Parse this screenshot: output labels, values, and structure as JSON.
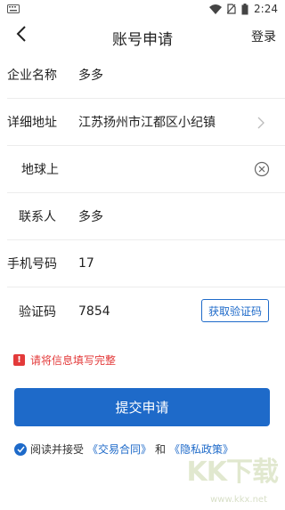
{
  "status_bar": {
    "time": "2:24",
    "keyboard_icon": "keyboard-icon",
    "wifi_icon": "wifi-icon",
    "sim_icon": "no-sim-icon",
    "battery_icon": "battery-icon"
  },
  "nav": {
    "title": "账号申请",
    "login_label": "登录",
    "back_icon": "chevron-left-icon"
  },
  "form": {
    "company": {
      "label": "企业名称",
      "value": "多多"
    },
    "address": {
      "label": "详细地址",
      "value": "江苏扬州市江都区小纪镇",
      "icon": "chevron-right-icon"
    },
    "address_detail": {
      "label": "地球上",
      "value": "",
      "icon": "clear-icon"
    },
    "contact": {
      "label": "联系人",
      "value": "多多"
    },
    "phone": {
      "label": "手机号码",
      "value": "17"
    },
    "code": {
      "label": "验证码",
      "value": "7854",
      "button_label": "获取验证码"
    }
  },
  "error": {
    "icon": "alert-icon",
    "text": "请将信息填写完整"
  },
  "submit_label": "提交申请",
  "agreement": {
    "prefix": "阅读并接受",
    "contract_link": "《交易合同》",
    "conjunction": "和",
    "privacy_link": "《隐私政策》",
    "check_icon": "checkmark-icon"
  },
  "watermark": {
    "brand": "KK下载",
    "url": "www.kkx.net"
  },
  "colors": {
    "accent": "#1e6ac9",
    "error": "#e33a3a",
    "divider": "#ececec"
  }
}
